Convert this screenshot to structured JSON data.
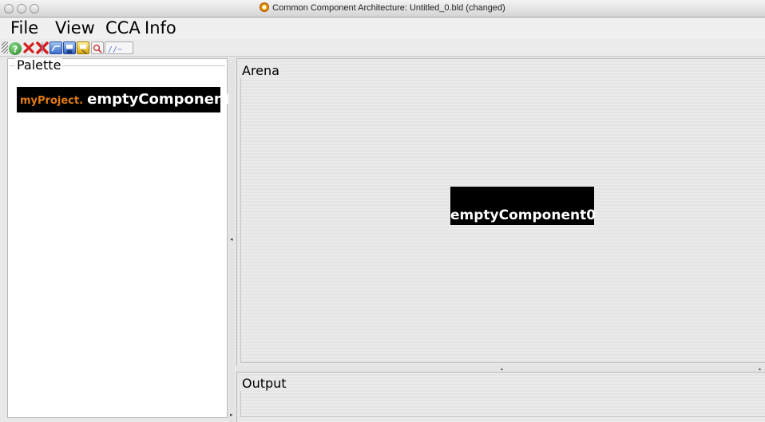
{
  "window": {
    "title": "Common Component Architecture: Untitled_0.bld (changed)"
  },
  "menu": {
    "items": [
      "File",
      "View",
      "CCA",
      "Info"
    ]
  },
  "toolbar": {
    "buttons": [
      {
        "icon": "help-icon",
        "color": "#2e8b2e"
      },
      {
        "icon": "delete-icon",
        "color": "#d42020"
      },
      {
        "icon": "delete-all-icon",
        "color": "#d42020"
      },
      {
        "icon": "open-icon",
        "color": "#3a6ecf"
      },
      {
        "icon": "save-icon",
        "color": "#3a6ecf"
      },
      {
        "icon": "save-as-icon",
        "color": "#e0b000"
      },
      {
        "icon": "search-icon",
        "color": "#cc3333"
      },
      {
        "icon": "script-icon",
        "color": "#5577cc"
      }
    ]
  },
  "palette": {
    "title": "Palette",
    "entries": [
      {
        "package": "myProject.",
        "name": "emptyComponent"
      }
    ]
  },
  "arena": {
    "title": "Arena",
    "components": [
      {
        "label": "emptyComponent0"
      }
    ]
  },
  "output": {
    "title": "Output"
  },
  "colors": {
    "package_accent": "#e07a10",
    "component_bg": "#000000"
  }
}
